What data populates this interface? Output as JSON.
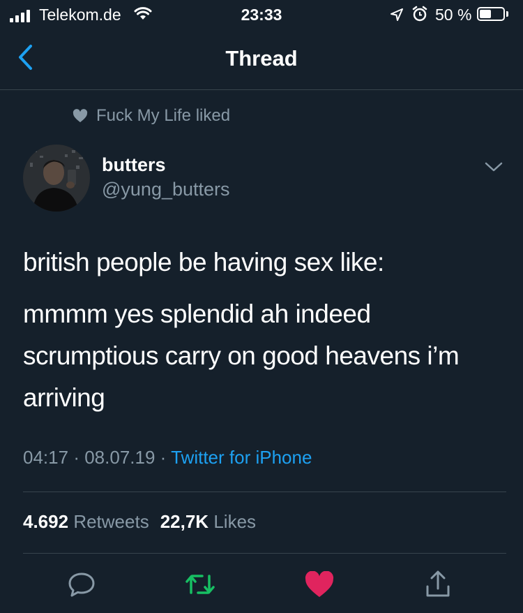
{
  "status_bar": {
    "carrier": "Telekom.de",
    "time": "23:33",
    "battery": "50 %",
    "battery_level": 0.5,
    "icons": [
      "signal-icon",
      "wifi-icon",
      "location-icon",
      "alarm-icon",
      "battery-icon"
    ]
  },
  "nav": {
    "title": "Thread",
    "back_icon": "chevron-left-icon"
  },
  "social_context": {
    "text": "Fuck My Life liked",
    "icon": "heart-icon"
  },
  "author": {
    "name": "butters",
    "handle": "@yung_butters"
  },
  "tweet": {
    "lines": [
      "british people be having sex like:",
      "mmmm yes splendid ah indeed scrumptious carry on good heavens i’m arriving"
    ],
    "time": "04:17",
    "date": "08.07.19",
    "separator": "·",
    "source": "Twitter for iPhone"
  },
  "stats": {
    "retweets_count": "4.692",
    "retweets_label": "Retweets",
    "likes_count": "22,7K",
    "likes_label": "Likes"
  },
  "actions": [
    "reply-icon",
    "retweet-icon",
    "like-icon",
    "share-icon"
  ],
  "colors": {
    "background": "#15202b",
    "text": "#ffffff",
    "secondary": "#8899a6",
    "accent": "#1da1f2",
    "retweet": "#17bf63",
    "like": "#e0245e",
    "divider": "#38444d"
  }
}
